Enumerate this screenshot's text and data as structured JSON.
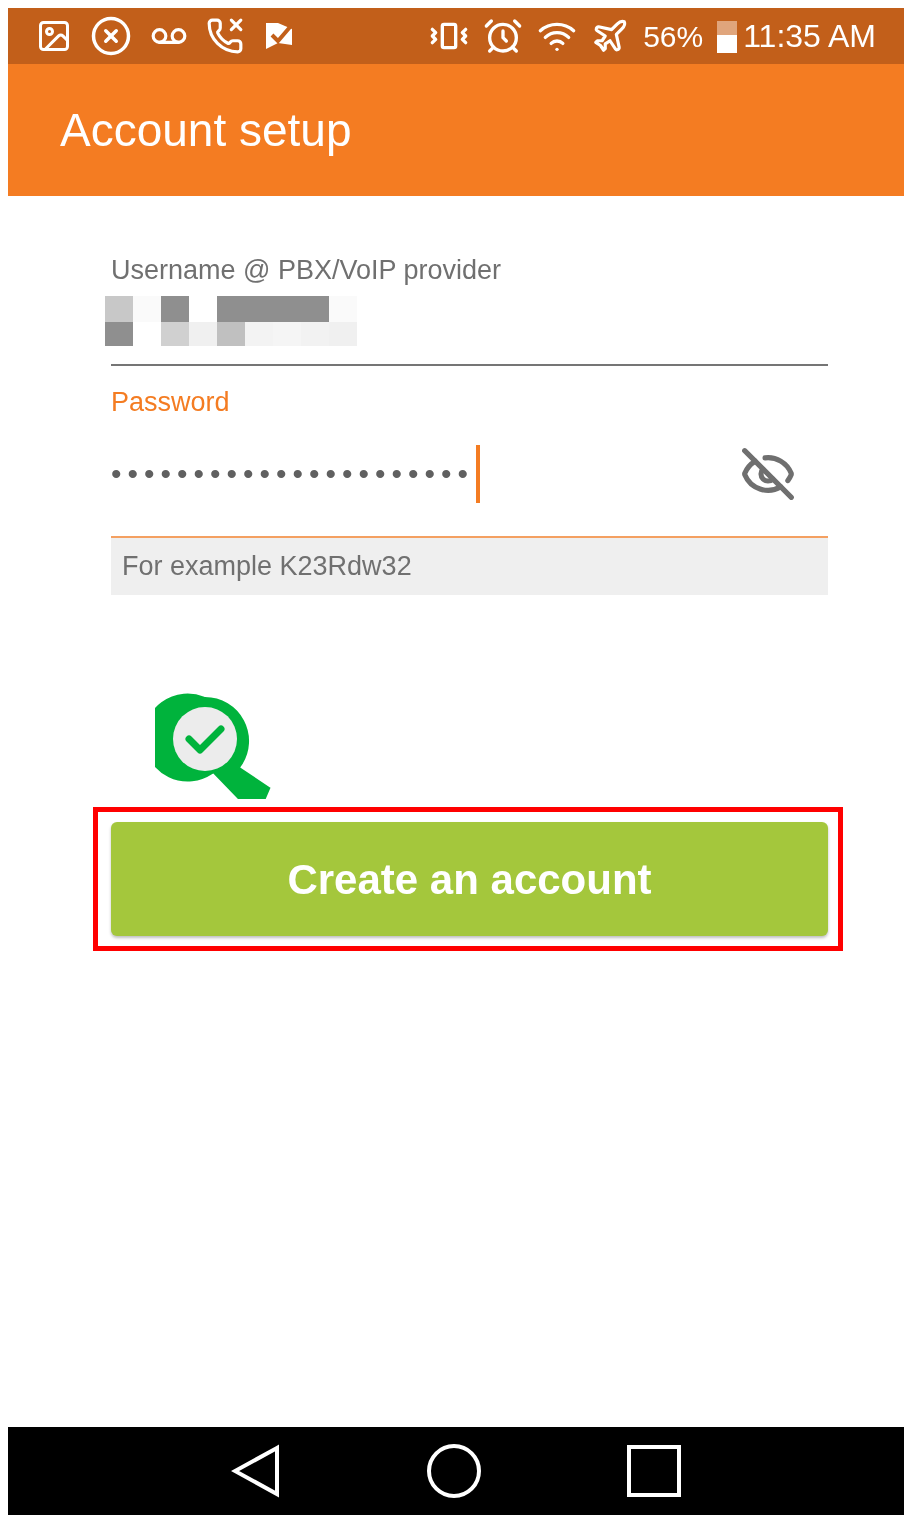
{
  "status_bar": {
    "battery": "56%",
    "time": "11:35 AM"
  },
  "app_bar": {
    "title": "Account setup"
  },
  "fields": [
    {
      "kind": "redacted",
      "label": "Username @ PBX/VoIP provider",
      "focused": false
    },
    {
      "kind": "password",
      "label": "Password",
      "value": "••••••••••••••••••••••",
      "focused": true,
      "hint": "For example K23Rdw32"
    }
  ],
  "create_button": {
    "label": "Create an account",
    "highlighted": true
  }
}
